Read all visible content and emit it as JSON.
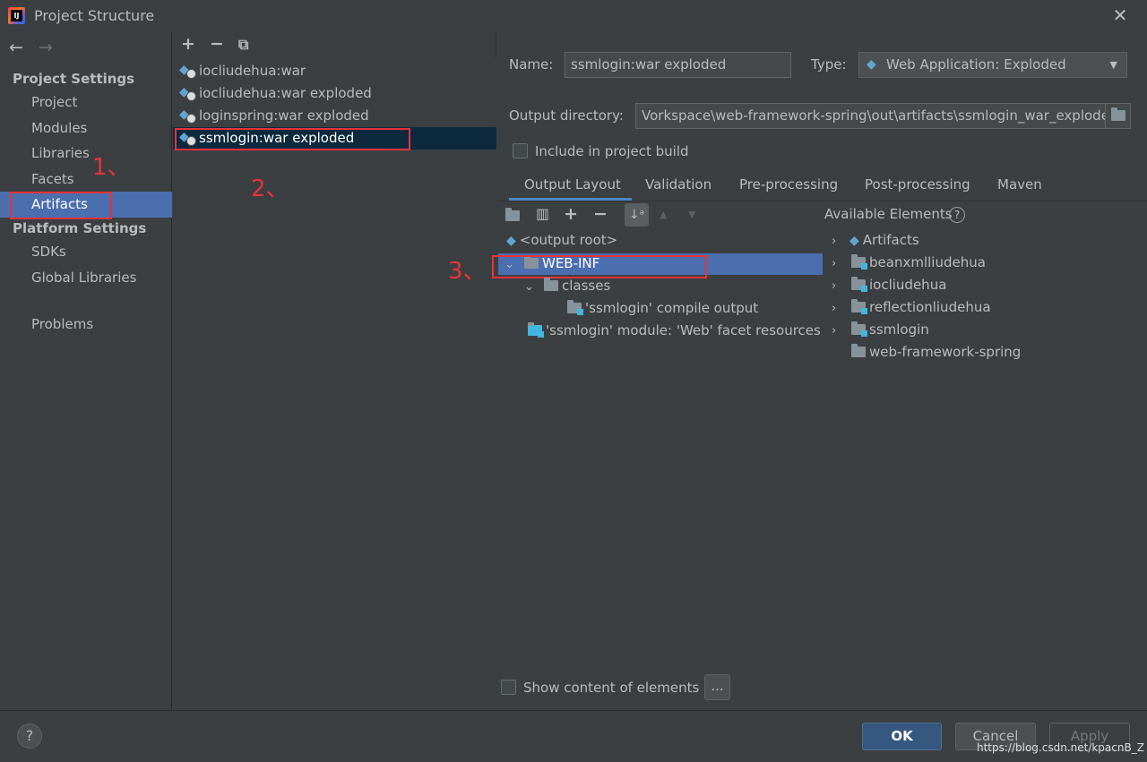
{
  "window": {
    "title": "Project Structure",
    "close": "✕"
  },
  "sidebar": {
    "back": "←",
    "forward": "→",
    "project_settings_header": "Project Settings",
    "items": [
      {
        "label": "Project"
      },
      {
        "label": "Modules"
      },
      {
        "label": "Libraries"
      },
      {
        "label": "Facets"
      },
      {
        "label": "Artifacts"
      }
    ],
    "platform_settings_header": "Platform Settings",
    "platform_items": [
      {
        "label": "SDKs"
      },
      {
        "label": "Global Libraries"
      }
    ],
    "problems": "Problems"
  },
  "artifacts_toolbar": {
    "add": "+",
    "remove": "−",
    "copy": "⧉"
  },
  "artifacts": [
    {
      "label": "iocliudehua:war"
    },
    {
      "label": "iocliudehua:war exploded"
    },
    {
      "label": "loginspring:war exploded"
    },
    {
      "label": "ssmlogin:war exploded"
    }
  ],
  "form": {
    "name_label": "Name:",
    "name_value": "ssmlogin:war exploded",
    "type_label": "Type:",
    "type_value": "Web Application: Exploded",
    "output_label": "Output directory:",
    "output_value": "Vorkspace\\web-framework-spring\\out\\artifacts\\ssmlogin_war_exploded",
    "include_build": "Include in project build"
  },
  "tabs": [
    {
      "label": "Output Layout"
    },
    {
      "label": "Validation"
    },
    {
      "label": "Pre-processing"
    },
    {
      "label": "Post-processing"
    },
    {
      "label": "Maven"
    }
  ],
  "layout_toolbar": {
    "add": "+",
    "remove": "−",
    "sort": "↓ᵃ",
    "up": "▲",
    "down": "▼"
  },
  "tree": {
    "root": "<output root>",
    "web_inf": "WEB-INF",
    "classes": "classes",
    "compile_output": "'ssmlogin' compile output",
    "facet_resources": "'ssmlogin' module: 'Web' facet resources"
  },
  "available": {
    "header": "Available Elements",
    "help": "?",
    "items": [
      {
        "label": "Artifacts"
      },
      {
        "label": "beanxmlliudehua"
      },
      {
        "label": "iocliudehua"
      },
      {
        "label": "reflectionliudehua"
      },
      {
        "label": "ssmlogin"
      },
      {
        "label": "web-framework-spring"
      }
    ]
  },
  "show_content": "Show content of elements",
  "ellipsis": "...",
  "buttons": {
    "ok": "OK",
    "cancel": "Cancel",
    "apply": "Apply",
    "help": "?"
  },
  "annotations": {
    "a1": "1、",
    "a2": "2、",
    "a3": "3、"
  },
  "watermark": "https://blog.csdn.net/kpacnB_Z",
  "colors": {
    "selection": "#4b6eaf",
    "accent": "#4a88c7",
    "annotation": "#e6333a",
    "ok_button": "#365880"
  }
}
